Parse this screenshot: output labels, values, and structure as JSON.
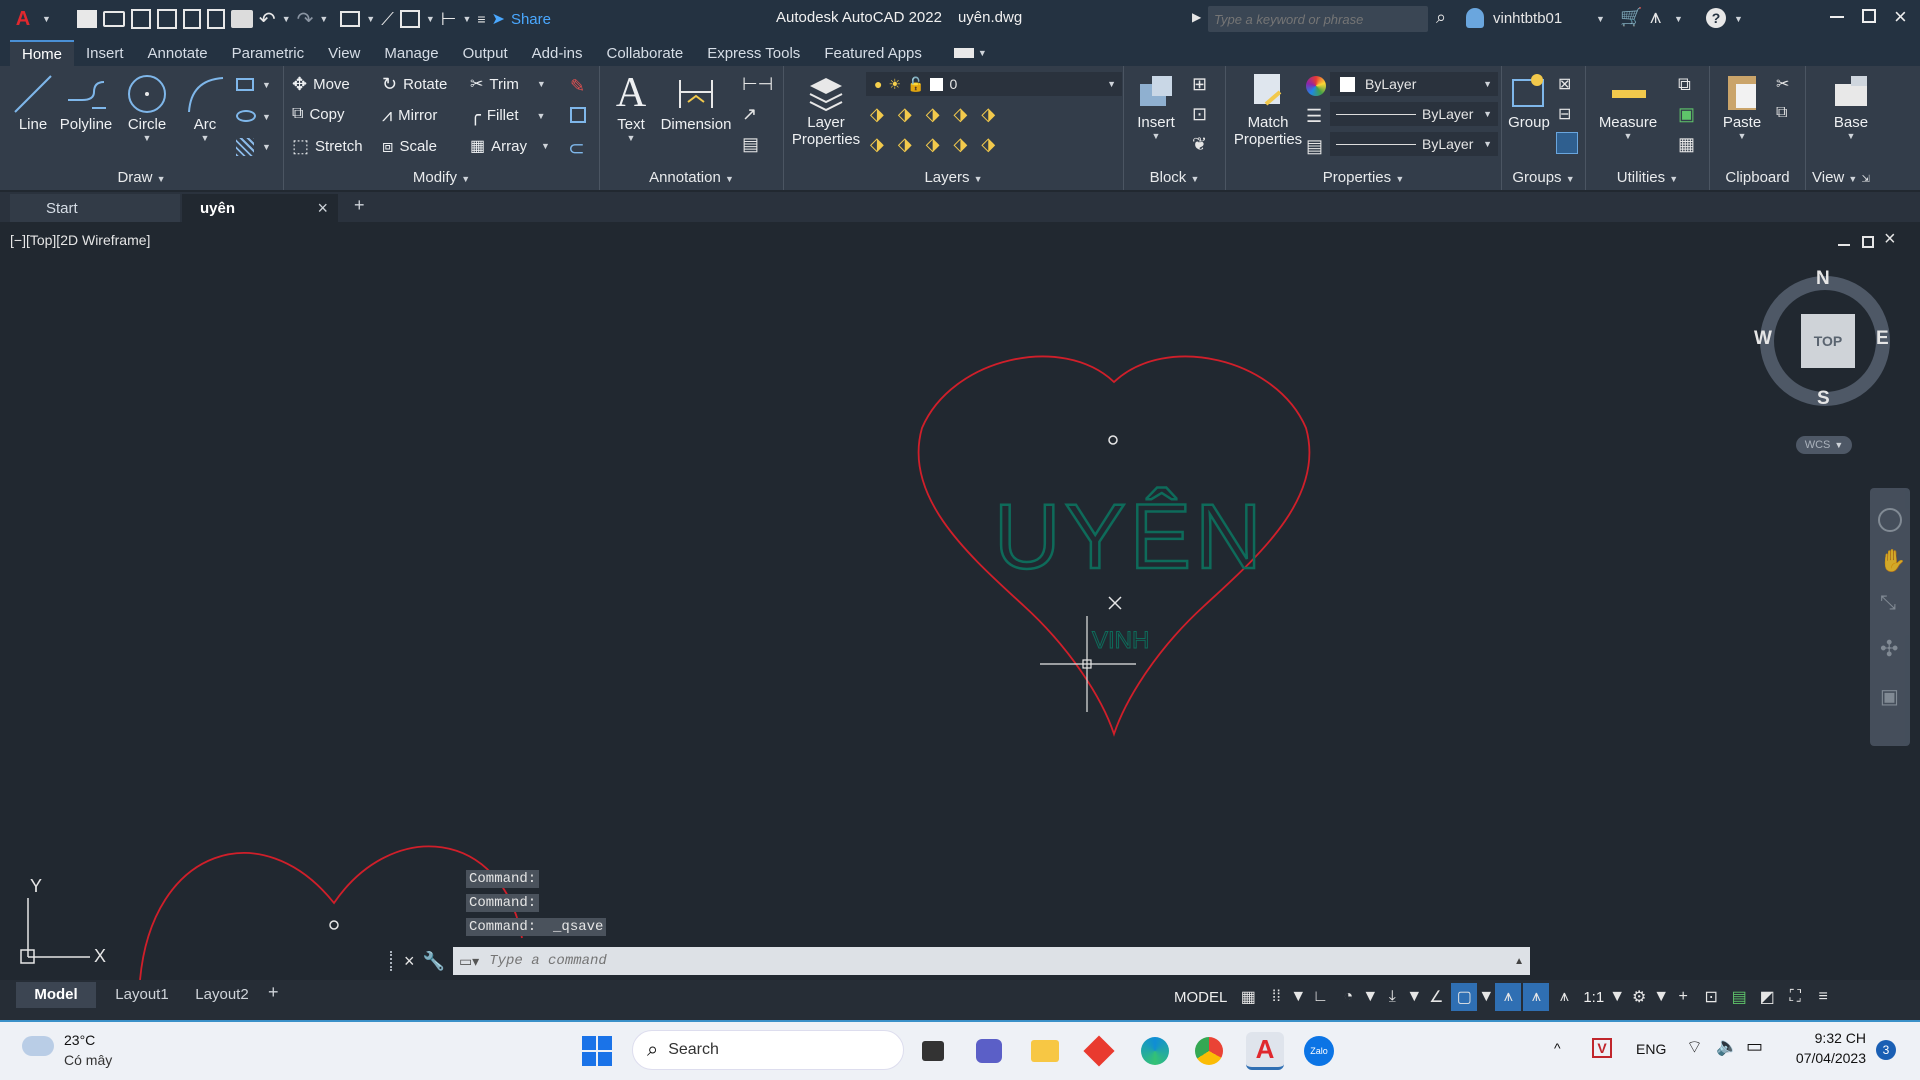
{
  "window": {
    "title": "Autodesk AutoCAD 2022",
    "filename": "uyên.dwg",
    "search_placeholder": "Type a keyword or phrase",
    "user": "vinhtbtb01",
    "share": "Share",
    "help": "?"
  },
  "ribbon_tabs": [
    "Home",
    "Insert",
    "Annotate",
    "Parametric",
    "View",
    "Manage",
    "Output",
    "Add-ins",
    "Collaborate",
    "Express Tools",
    "Featured Apps"
  ],
  "draw": {
    "line": "Line",
    "polyline": "Polyline",
    "circle": "Circle",
    "arc": "Arc",
    "label": "Draw"
  },
  "modify": {
    "move": "Move",
    "rotate": "Rotate",
    "trim": "Trim",
    "copy": "Copy",
    "mirror": "Mirror",
    "fillet": "Fillet",
    "stretch": "Stretch",
    "scale": "Scale",
    "array": "Array",
    "label": "Modify"
  },
  "annotation": {
    "text": "Text",
    "dimension": "Dimension",
    "label": "Annotation"
  },
  "layers": {
    "layer_props_1": "Layer",
    "layer_props_2": "Properties",
    "current_layer": "0",
    "label": "Layers"
  },
  "block": {
    "insert": "Insert",
    "label": "Block"
  },
  "properties": {
    "match_1": "Match",
    "match_2": "Properties",
    "color": "ByLayer",
    "linetype": "ByLayer",
    "lineweight": "ByLayer",
    "label": "Properties"
  },
  "groups": {
    "group": "Group",
    "label": "Groups"
  },
  "utilities": {
    "measure": "Measure",
    "label": "Utilities"
  },
  "clipboard": {
    "paste": "Paste",
    "label": "Clipboard"
  },
  "view": {
    "base": "Base",
    "label": "View"
  },
  "file_tabs": {
    "start": "Start",
    "active": "uyên"
  },
  "viewport": {
    "label": "[−][Top][2D Wireframe]",
    "viewcube_top": "TOP",
    "north": "N",
    "south": "S",
    "east": "E",
    "west": "W",
    "wcs": "WCS",
    "text_uyen": "UYÊN",
    "text_vinh": "VINH"
  },
  "ucs": {
    "x": "X",
    "y": "Y"
  },
  "command_history": [
    "Command:",
    "Command:",
    "Command:  _qsave"
  ],
  "command_placeholder": "Type a command",
  "layout_tabs": [
    "Model",
    "Layout1",
    "Layout2"
  ],
  "status": {
    "model": "MODEL",
    "scale": "1:1"
  },
  "taskbar": {
    "temp": "23°C",
    "weather": "Có mây",
    "search": "Search",
    "lang": "ENG",
    "time": "9:32 CH",
    "date": "07/04/2023",
    "badge": "3"
  },
  "colors": {
    "heart": "#d01f2a",
    "text": "#0e6b5a",
    "accent": "#4a90d6"
  }
}
